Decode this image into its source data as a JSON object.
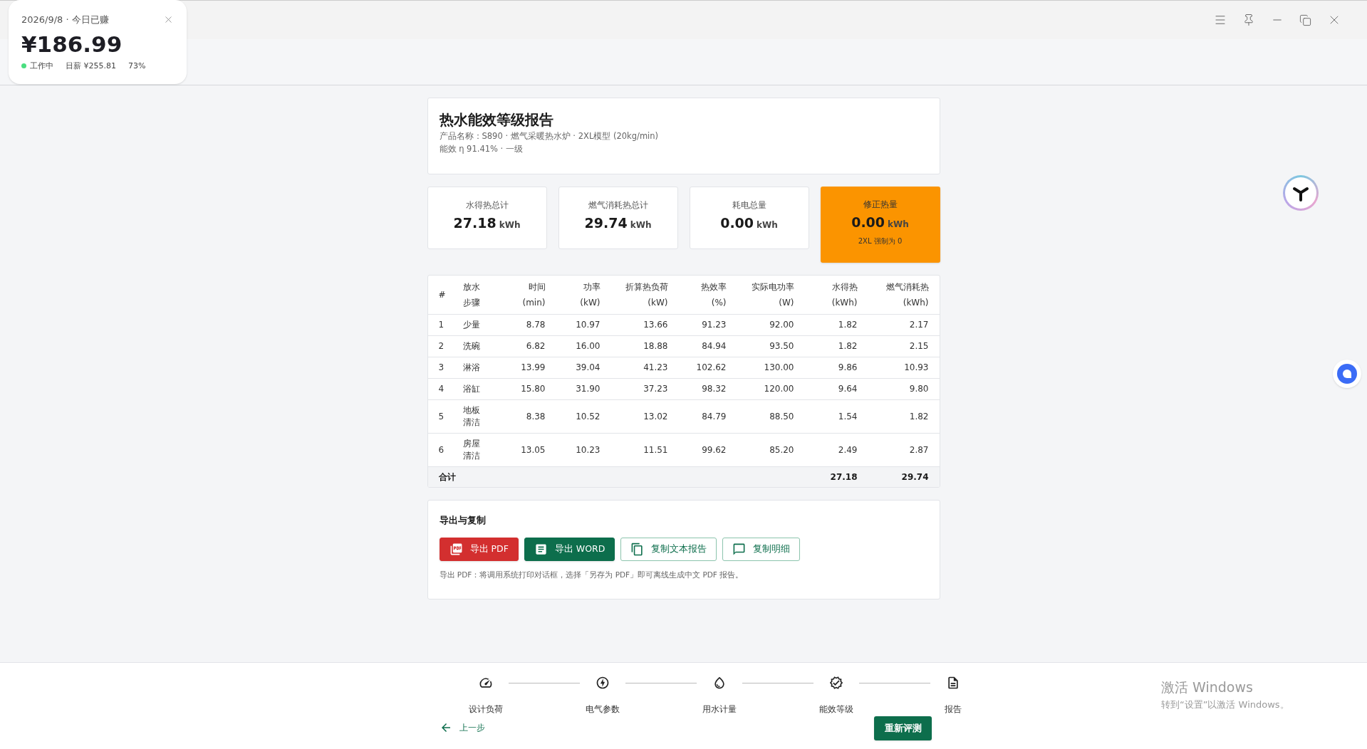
{
  "popup": {
    "date_label": "2026/9/8 · 今日已赚",
    "amount": "¥186.99",
    "status": "工作中",
    "daily_wage": "日薪 ¥255.81",
    "percent": "73%"
  },
  "report": {
    "title": "热水能效等级报告",
    "lines": [
      "产品名称：S890 · 燃气采暖热水炉 · 2XL模型 (20kg/min)",
      "能效 η 91.41% · 一级"
    ]
  },
  "stats": [
    {
      "label": "水得热总计",
      "value": "27.18",
      "unit": "kWh",
      "highlighted": false
    },
    {
      "label": "燃气消耗热总计",
      "value": "29.74",
      "unit": "kWh",
      "highlighted": false
    },
    {
      "label": "耗电总量",
      "value": "0.00",
      "unit": "kWh",
      "highlighted": false
    },
    {
      "label": "修正热量",
      "value": "0.00",
      "unit": "kWh",
      "note": "2XL 强制为 0",
      "highlighted": true
    }
  ],
  "table": {
    "columns": [
      "#",
      "放水步骤",
      "时间\n(min)",
      "功率\n(kW)",
      "折算热负荷\n(kW)",
      "热效率\n(%)",
      "实际电功率\n(W)",
      "水得热\n(kWh)",
      "燃气消耗热\n(kWh)"
    ],
    "rows": [
      [
        "1",
        "少量",
        "8.78",
        "10.97",
        "13.66",
        "91.23",
        "92.00",
        "1.82",
        "2.17"
      ],
      [
        "2",
        "洗碗",
        "6.82",
        "16.00",
        "18.88",
        "84.94",
        "93.50",
        "1.82",
        "2.15"
      ],
      [
        "3",
        "淋浴",
        "13.99",
        "39.04",
        "41.23",
        "102.62",
        "130.00",
        "9.86",
        "10.93"
      ],
      [
        "4",
        "浴缸",
        "15.80",
        "31.90",
        "37.23",
        "98.32",
        "120.00",
        "9.64",
        "9.80"
      ],
      [
        "5",
        "地板清洁",
        "8.38",
        "10.52",
        "13.02",
        "84.79",
        "88.50",
        "1.54",
        "1.82"
      ],
      [
        "6",
        "房屋清洁",
        "13.05",
        "10.23",
        "11.51",
        "99.62",
        "85.20",
        "2.49",
        "2.87"
      ]
    ],
    "total": {
      "label": "合计",
      "water_heat": "27.18",
      "gas_heat": "29.74"
    }
  },
  "export": {
    "title": "导出与复制",
    "buttons": [
      {
        "label": "导出 PDF",
        "kind": "pdf"
      },
      {
        "label": "导出 WORD",
        "kind": "word"
      },
      {
        "label": "复制文本报告",
        "kind": "copy"
      },
      {
        "label": "复制明细",
        "kind": "detail"
      }
    ],
    "note": "导出 PDF：将调用系统打印对话框，选择「另存为 PDF」即可离线生成中文 PDF 报告。"
  },
  "steps": [
    {
      "label": "设计负荷",
      "kind": "gauge"
    },
    {
      "label": "电气参数",
      "kind": "bolt"
    },
    {
      "label": "用水计量",
      "kind": "drop"
    },
    {
      "label": "能效等级",
      "kind": "badge"
    },
    {
      "label": "报告",
      "kind": "document"
    }
  ],
  "back": "上一步",
  "restart": "重新评测",
  "activation": {
    "title": "激活 Windows",
    "text": "转到“设置”以激活 Windows。"
  }
}
